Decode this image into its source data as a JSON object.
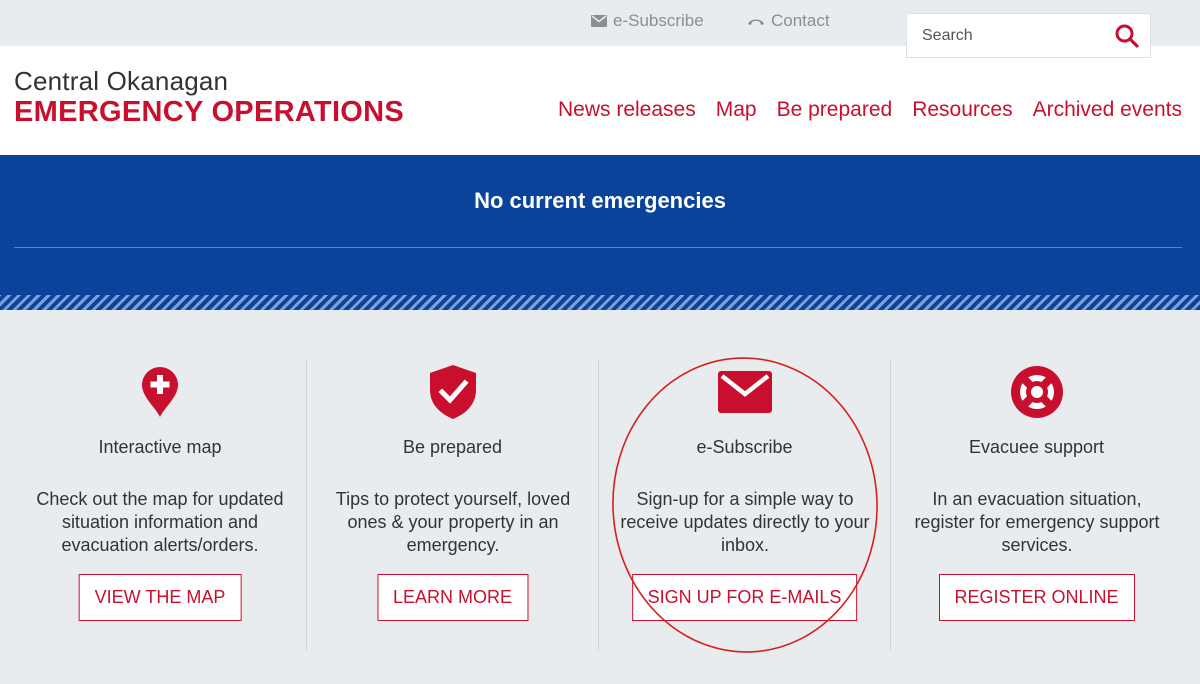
{
  "utility": {
    "subscribe_label": "e-Subscribe",
    "contact_label": "Contact",
    "search_placeholder": "Search"
  },
  "brand": {
    "line1": "Central Okanagan",
    "line2": "EMERGENCY OPERATIONS"
  },
  "nav": {
    "items": [
      {
        "label": "News releases"
      },
      {
        "label": "Map"
      },
      {
        "label": "Be prepared"
      },
      {
        "label": "Resources"
      },
      {
        "label": "Archived events"
      }
    ]
  },
  "banner": {
    "title": "No current emergencies"
  },
  "cards": [
    {
      "icon": "map-pin-plus-icon",
      "title": "Interactive map",
      "text": "Check out the map for updated situation information and evacuation alerts/orders.",
      "button": "VIEW THE MAP"
    },
    {
      "icon": "shield-check-icon",
      "title": "Be prepared",
      "text": "Tips to protect yourself, loved ones & your property in an emergency.",
      "button": "LEARN MORE"
    },
    {
      "icon": "envelope-icon",
      "title": "e-Subscribe",
      "text": "Sign-up for a simple way to receive updates directly to your inbox.",
      "button": "SIGN UP FOR E-MAILS"
    },
    {
      "icon": "lifebuoy-icon",
      "title": "Evacuee support",
      "text": "In an evacuation situation, register for emergency support services.",
      "button": "REGISTER ONLINE"
    }
  ],
  "colors": {
    "brand_red": "#c8102e",
    "banner_blue": "#0a4399",
    "background": "#e9ecef",
    "annotation_red": "#d62020"
  }
}
